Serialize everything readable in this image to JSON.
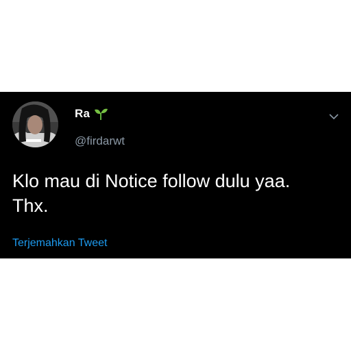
{
  "tweet": {
    "display_name": "Ra",
    "name_emoji": "seedling-icon",
    "handle": "@firdarwt",
    "text": "Klo mau di Notice follow dulu yaa.\nThx.",
    "translate_label": "Terjemahkan Tweet",
    "avatar_icon": "profile-photo",
    "menu_icon": "chevron-down-icon"
  },
  "colors": {
    "card_background": "#000000",
    "page_background": "#ffffff",
    "text": "#ffffff",
    "secondary_text": "#8b98a5",
    "link": "#1d9bf0"
  }
}
